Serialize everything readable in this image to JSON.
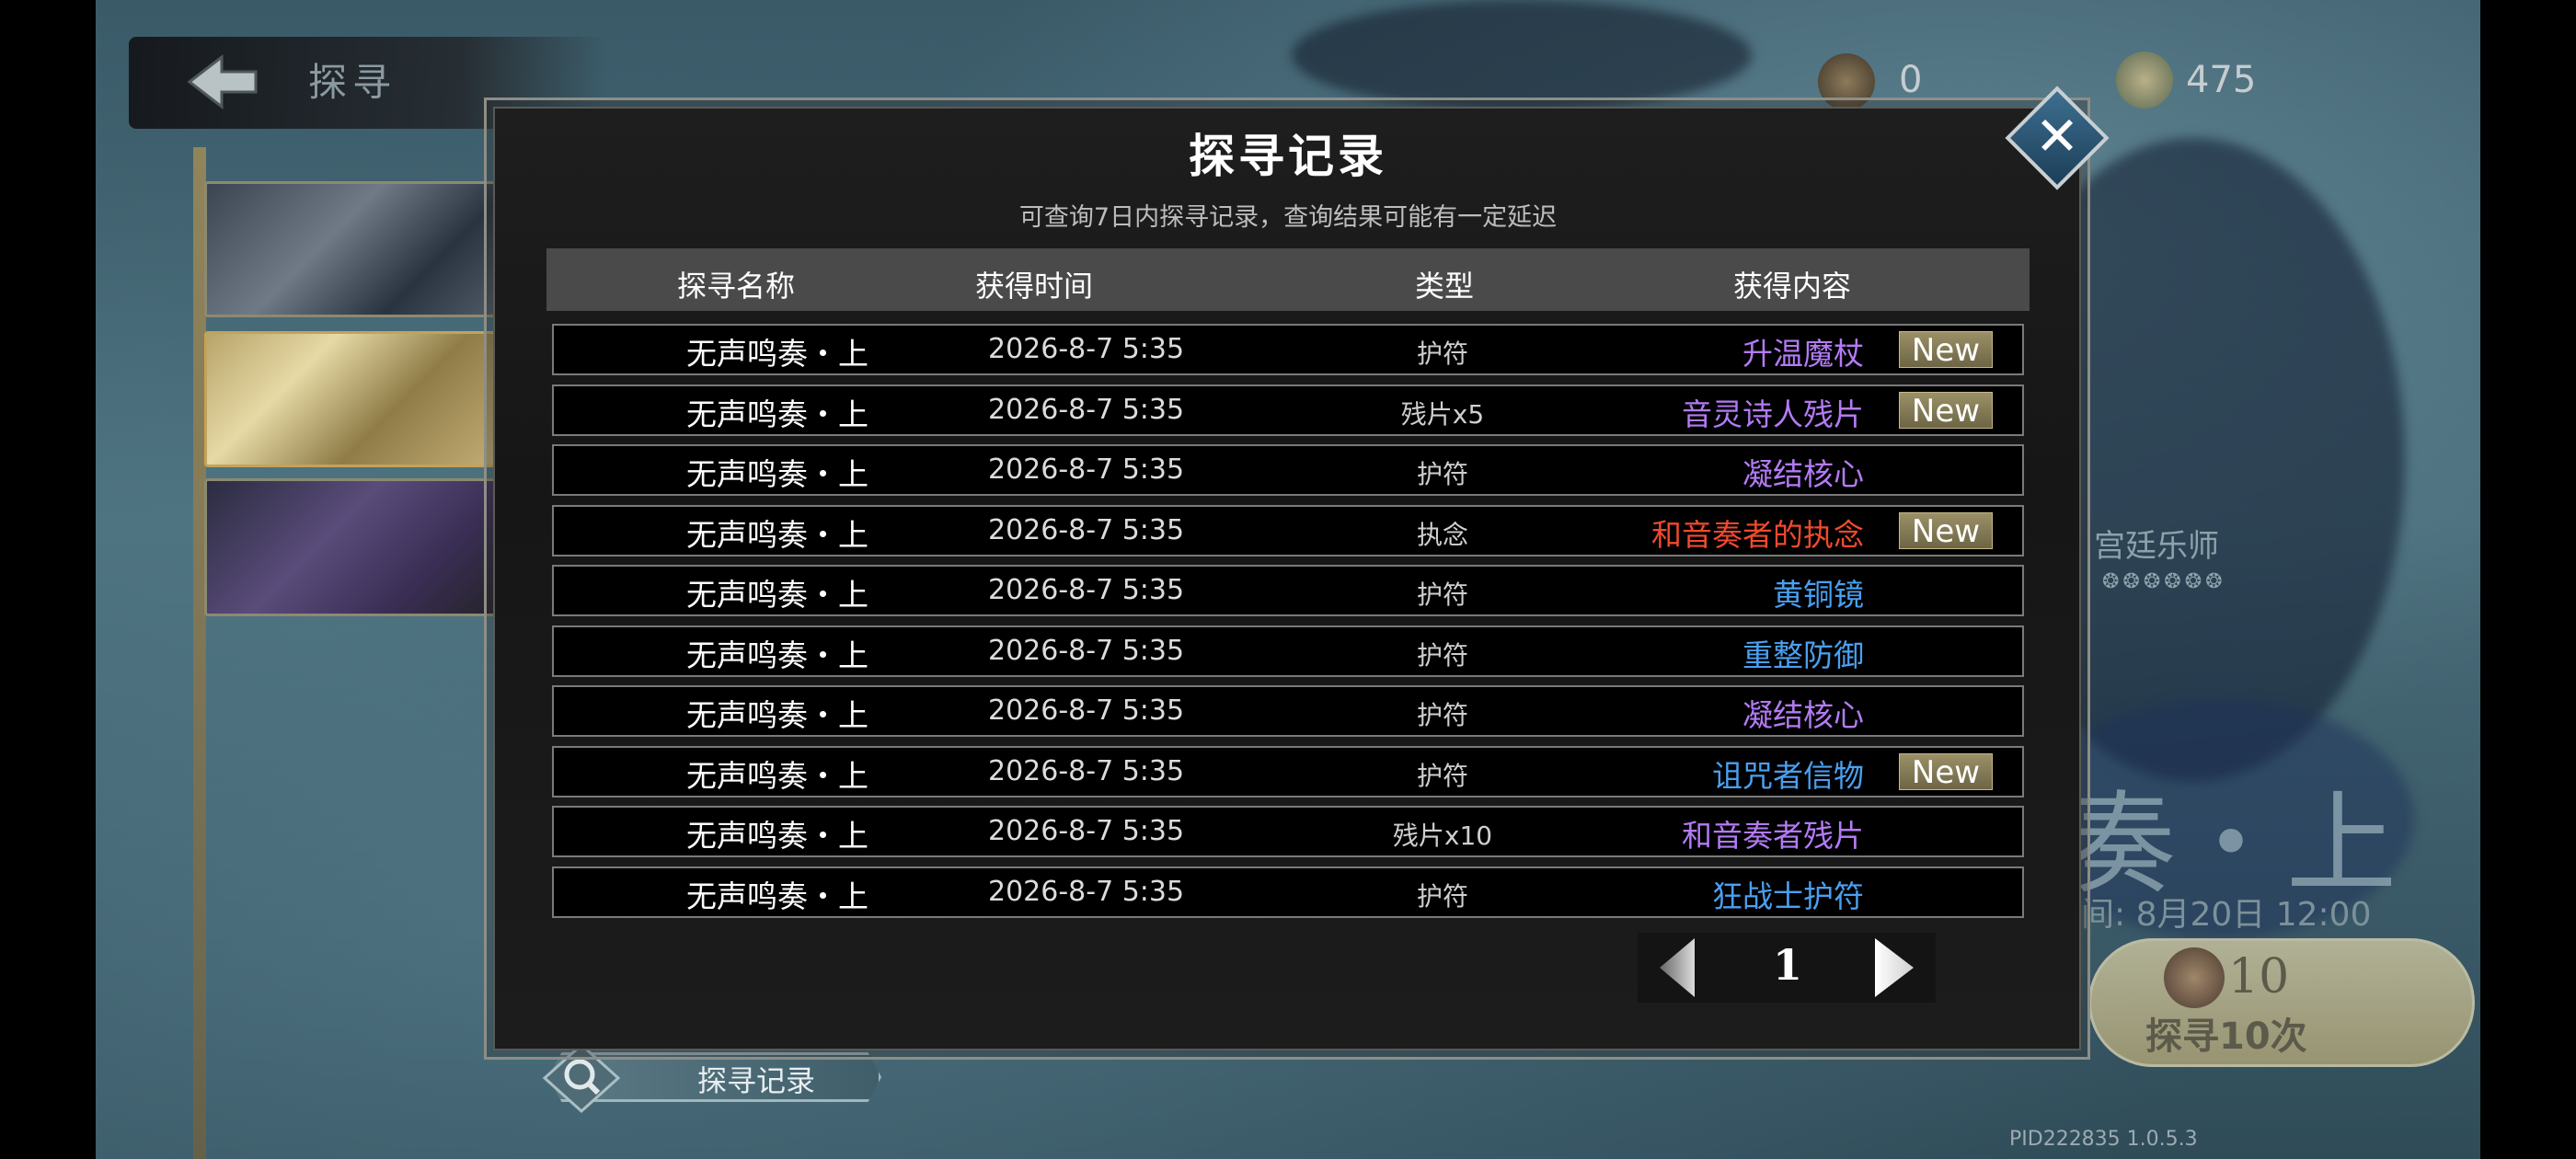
{
  "header": {
    "back_label": "探寻",
    "currency_primary_value": "0",
    "currency_secondary_value": "475"
  },
  "banner": {
    "character_name": "宫廷乐师",
    "stars": "❂❂❂❂❂❂",
    "title_partial": "奏・上",
    "deadline_text": "间: 8月20日 12:00",
    "pull_count": "10",
    "pull_label": "探寻10次",
    "pid": "PID222835  1.0.5.3"
  },
  "record_button": {
    "label": "探寻记录"
  },
  "modal": {
    "title": "探寻记录",
    "subtitle": "可查询7日内探寻记录，查询结果可能有一定延迟",
    "columns": [
      "探寻名称",
      "获得时间",
      "类型",
      "获得内容"
    ],
    "rows": [
      {
        "name": "无声鸣奏・上",
        "time": "2026-8-7 5:35",
        "type": "护符",
        "item": "升温魔杖",
        "color": "#b37bf5",
        "new": "New"
      },
      {
        "name": "无声鸣奏・上",
        "time": "2026-8-7 5:35",
        "type": "残片x5",
        "item": "音灵诗人残片",
        "color": "#b37bf5",
        "new": "New"
      },
      {
        "name": "无声鸣奏・上",
        "time": "2026-8-7 5:35",
        "type": "护符",
        "item": "凝结核心",
        "color": "#b37bf5",
        "new": ""
      },
      {
        "name": "无声鸣奏・上",
        "time": "2026-8-7 5:35",
        "type": "执念",
        "item": "和音奏者的执念",
        "color": "#f04a2e",
        "new": "New"
      },
      {
        "name": "无声鸣奏・上",
        "time": "2026-8-7 5:35",
        "type": "护符",
        "item": "黄铜镜",
        "color": "#4aa0f0",
        "new": ""
      },
      {
        "name": "无声鸣奏・上",
        "time": "2026-8-7 5:35",
        "type": "护符",
        "item": "重整防御",
        "color": "#4aa0f0",
        "new": ""
      },
      {
        "name": "无声鸣奏・上",
        "time": "2026-8-7 5:35",
        "type": "护符",
        "item": "凝结核心",
        "color": "#b37bf5",
        "new": ""
      },
      {
        "name": "无声鸣奏・上",
        "time": "2026-8-7 5:35",
        "type": "护符",
        "item": "诅咒者信物",
        "color": "#4aa0f0",
        "new": "New"
      },
      {
        "name": "无声鸣奏・上",
        "time": "2026-8-7 5:35",
        "type": "残片x10",
        "item": "和音奏者残片",
        "color": "#b37bf5",
        "new": ""
      },
      {
        "name": "无声鸣奏・上",
        "time": "2026-8-7 5:35",
        "type": "护符",
        "item": "狂战士护符",
        "color": "#4aa0f0",
        "new": ""
      }
    ],
    "page": "1",
    "close_symbol": "✕"
  },
  "icons": {
    "back": "back-arrow-icon",
    "close": "close-icon",
    "prev": "prev-page-icon",
    "next": "next-page-icon",
    "search": "magnifier-icon"
  }
}
